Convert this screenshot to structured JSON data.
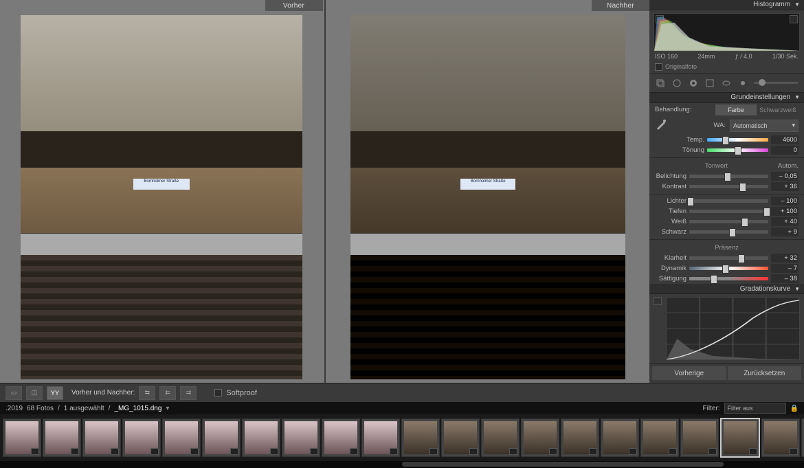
{
  "compare": {
    "before_label": "Vorher",
    "after_label": "Nachher",
    "sign_text": "Bornholmer Straße"
  },
  "right": {
    "histogram_title": "Histogramm",
    "meta": {
      "iso": "ISO 160",
      "focal": "24mm",
      "aperture": "ƒ / 4,0",
      "shutter": "1/30 Sek."
    },
    "original_label": "Originalfoto",
    "basic": {
      "title": "Grundeinstellungen",
      "treatment_label": "Behandlung:",
      "treatment_color": "Farbe",
      "treatment_bw": "Schwarzweiß",
      "wb_label": "WA:",
      "wb_value": "Automatisch",
      "temp_label": "Temp.",
      "temp_value": "4600",
      "tint_label": "Tönung",
      "tint_value": "0",
      "tone_hdr": "Tonwert",
      "tone_auto": "Autom.",
      "exposure_label": "Belichtung",
      "exposure_value": "– 0,05",
      "contrast_label": "Kontrast",
      "contrast_value": "+ 36",
      "highlights_label": "Lichter",
      "highlights_value": "– 100",
      "shadows_label": "Tiefen",
      "shadows_value": "+ 100",
      "whites_label": "Weiß",
      "whites_value": "+ 40",
      "blacks_label": "Schwarz",
      "blacks_value": "+ 9",
      "presence_hdr": "Präsenz",
      "clarity_label": "Klarheit",
      "clarity_value": "+ 32",
      "vibrance_label": "Dynamik",
      "vibrance_value": "– 7",
      "saturation_label": "Sättigung",
      "saturation_value": "– 38"
    },
    "curve_title": "Gradationskurve",
    "prev_btn": "Vorherige",
    "reset_btn": "Zurücksetzen"
  },
  "toolbar": {
    "compare_label": "Vorher und Nachher:",
    "softproof_label": "Softproof"
  },
  "info": {
    "date": ".2019",
    "count": "68 Fotos",
    "sel": "1 ausgewählt",
    "file": "_MG_1015.dng",
    "filter_label": "Filter:",
    "filter_value": "Filter aus"
  },
  "filmstrip": {
    "count": 21,
    "selected_index": 18,
    "pink_until": 10
  }
}
